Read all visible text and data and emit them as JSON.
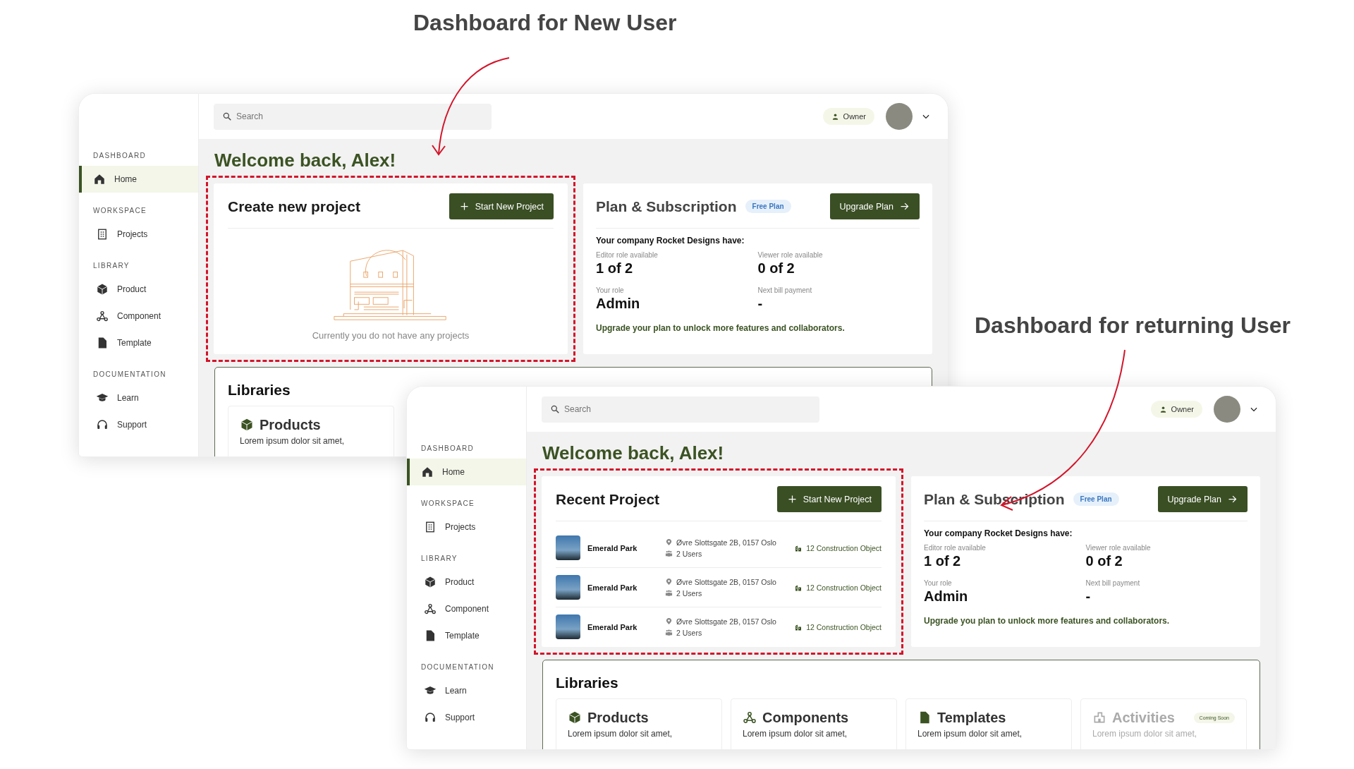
{
  "screens": [
    {
      "caption": "Dashboard for New User",
      "sidebar": {
        "sections": [
          {
            "label": "DASHBOARD",
            "items": [
              {
                "label": "Home",
                "selected": true
              }
            ]
          },
          {
            "label": "WORKSPACE",
            "items": [
              {
                "label": "Projects",
                "selected": false
              }
            ]
          },
          {
            "label": "LIBRARY",
            "items": [
              {
                "label": "Product",
                "selected": false
              },
              {
                "label": "Component",
                "selected": false
              },
              {
                "label": "Template",
                "selected": false
              }
            ]
          },
          {
            "label": "DOCUMENTATION",
            "items": [
              {
                "label": "Learn",
                "selected": false
              },
              {
                "label": "Support",
                "selected": false
              }
            ]
          }
        ]
      },
      "search": {
        "placeholder": "Search"
      },
      "role_badge": "Owner",
      "welcome": "Welcome back, Alex!",
      "main_card": {
        "kind": "empty",
        "title": "Create new project",
        "button": "Start New Project",
        "message": "Currently you do not have any projects"
      },
      "plan": {
        "title": "Plan & Subscription",
        "badge": "Free Plan",
        "button": "Upgrade Plan",
        "intro": "Your company **Rocket Designs** have:",
        "stats": [
          {
            "label": "Editor role available",
            "value": "1 of 2"
          },
          {
            "label": "Viewer role available",
            "value": "0 of 2"
          },
          {
            "label": "Your role",
            "value": "Admin"
          },
          {
            "label": "Next bill payment",
            "value": "-"
          }
        ],
        "note": "Upgrade your plan to unlock more features and collaborators."
      },
      "libraries": {
        "title": "Libraries",
        "items": [
          {
            "title": "Products",
            "description": "Lorem ipsum dolor sit amet,",
            "disabled": false
          }
        ]
      }
    },
    {
      "caption": "Dashboard for returning User",
      "sidebar": {
        "sections": [
          {
            "label": "DASHBOARD",
            "items": [
              {
                "label": "Home",
                "selected": true
              }
            ]
          },
          {
            "label": "WORKSPACE",
            "items": [
              {
                "label": "Projects",
                "selected": false
              }
            ]
          },
          {
            "label": "LIBRARY",
            "items": [
              {
                "label": "Product",
                "selected": false
              },
              {
                "label": "Component",
                "selected": false
              },
              {
                "label": "Template",
                "selected": false
              }
            ]
          },
          {
            "label": "DOCUMENTATION",
            "items": [
              {
                "label": "Learn",
                "selected": false
              },
              {
                "label": "Support",
                "selected": false
              }
            ]
          }
        ]
      },
      "search": {
        "placeholder": "Search"
      },
      "role_badge": "Owner",
      "welcome": "Welcome back, Alex!",
      "main_card": {
        "kind": "recent",
        "title": "Recent Project",
        "button": "Start New Project",
        "rows": [
          {
            "name": "Emerald Park",
            "address": "Øvre Slottsgate 2B, 0157 Oslo",
            "users": "2 Users",
            "objects": "12 Construction Object"
          },
          {
            "name": "Emerald Park",
            "address": "Øvre Slottsgate 2B, 0157 Oslo",
            "users": "2 Users",
            "objects": "12 Construction Object"
          },
          {
            "name": "Emerald Park",
            "address": "Øvre Slottsgate 2B, 0157 Oslo",
            "users": "2 Users",
            "objects": "12 Construction Object"
          }
        ]
      },
      "plan": {
        "title": "Plan & Subscription",
        "badge": "Free Plan",
        "button": "Upgrade Plan",
        "intro": "Your company **Rocket Designs** have:",
        "stats": [
          {
            "label": "Editor role available",
            "value": "1 of 2"
          },
          {
            "label": "Viewer role available",
            "value": "0 of 2"
          },
          {
            "label": "Your role",
            "value": "Admin"
          },
          {
            "label": "Next bill payment",
            "value": "-"
          }
        ],
        "note": "Upgrade you plan to unlock more features and collaborators."
      },
      "libraries": {
        "title": "Libraries",
        "items": [
          {
            "title": "Products",
            "description": "Lorem ipsum dolor sit amet,",
            "disabled": false
          },
          {
            "title": "Components",
            "description": "Lorem ipsum dolor sit amet,",
            "disabled": false
          },
          {
            "title": "Templates",
            "description": "Lorem ipsum dolor sit amet,",
            "disabled": false
          },
          {
            "title": "Activities",
            "description": "Lorem ipsum dolor sit amet,",
            "disabled": true,
            "badge": "Coming Soon"
          }
        ]
      }
    }
  ]
}
